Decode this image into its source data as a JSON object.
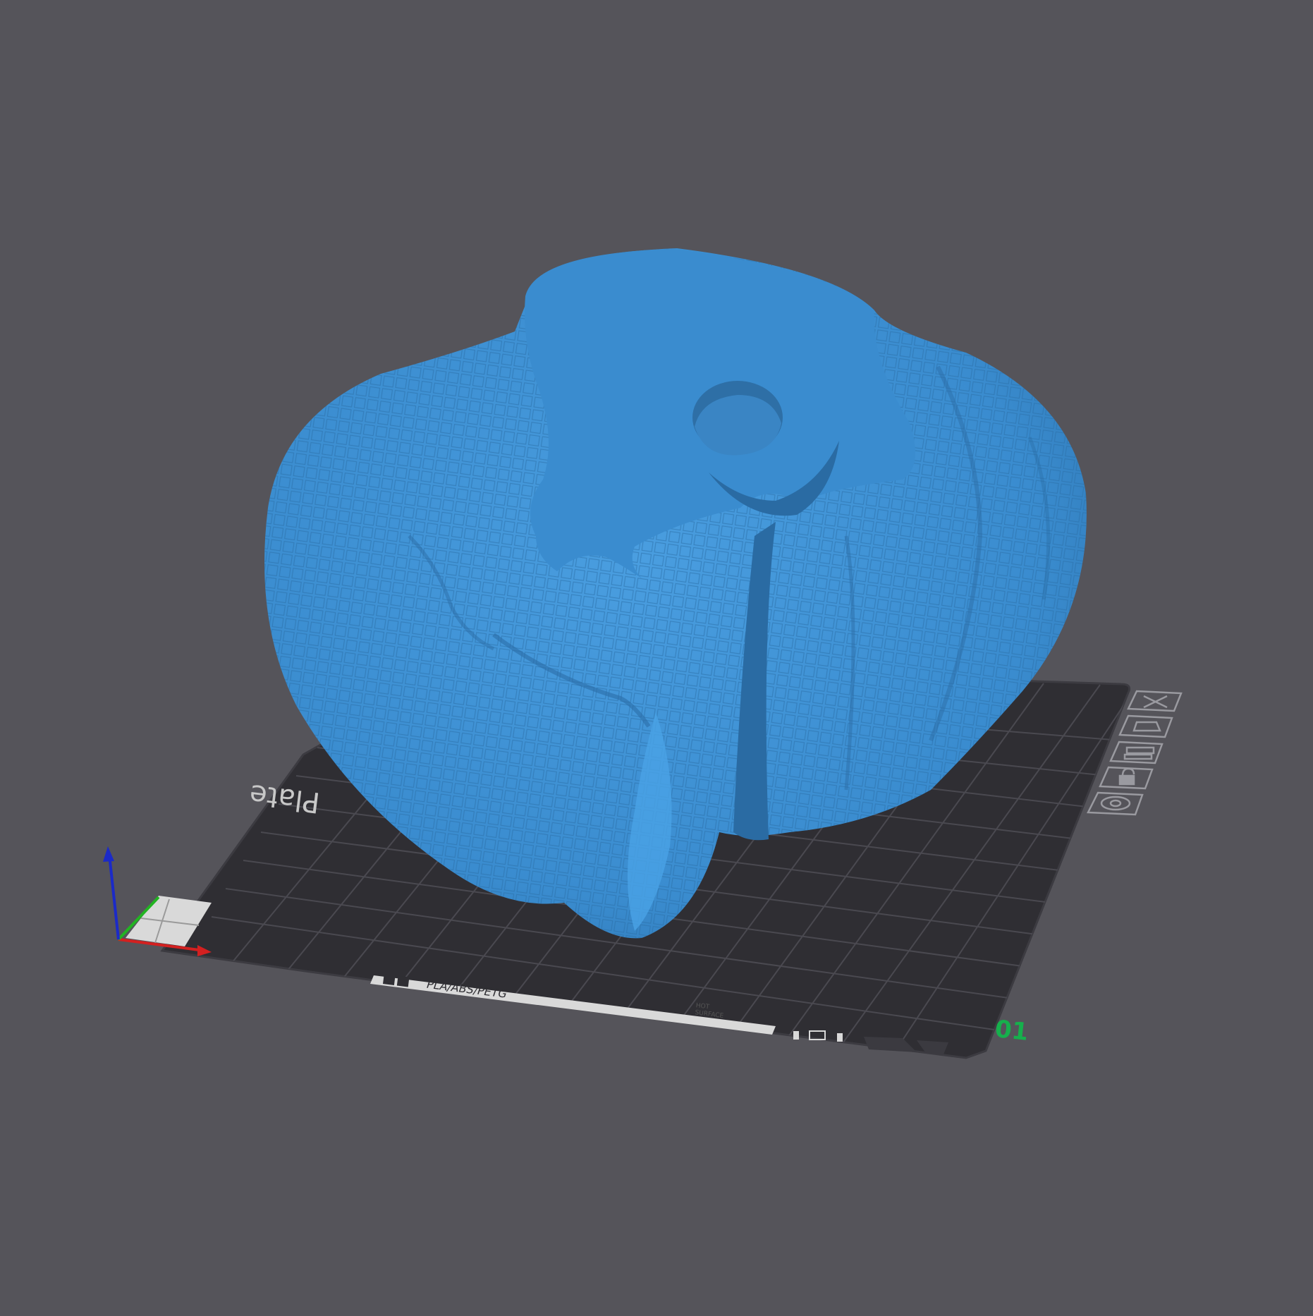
{
  "viewport": {
    "background": "#55545a",
    "model_color": "#3a8ccf",
    "plate_color": "#2f2e33",
    "grid_color": "#4a4950"
  },
  "plate": {
    "name_label": "Plate",
    "material_label": "PLA/ABS/PETG",
    "hot_surface_line1": "HOT",
    "hot_surface_line2": "SURFACE",
    "plate_number": "01",
    "plate_number_color": "#16b04c"
  },
  "plate_toolbar": {
    "icons": [
      "close-icon",
      "auto-orient-icon",
      "arrange-icon",
      "lock-icon",
      "settings-icon"
    ]
  },
  "axes": {
    "x_color": "#d32020",
    "y_color": "#22b422",
    "z_color": "#1b2ac8"
  }
}
